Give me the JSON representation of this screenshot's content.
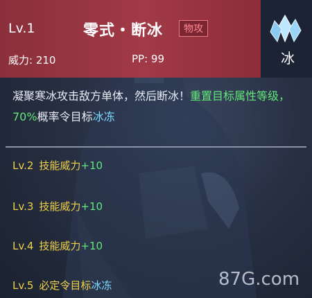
{
  "header": {
    "level": "Lv.1",
    "skill_name": "零式・断冰",
    "category_tag": "物攻",
    "power_label": "威力: 210",
    "pp_label": "PP: 99"
  },
  "element": {
    "icon": "ice-crystal-icon",
    "label": "冰"
  },
  "description": {
    "part1": "凝聚寒冰攻击敌方单体，然后断冰！",
    "part2": "重置目标属性等级，",
    "part3": "70%",
    "part4": "概率令目标",
    "part5": "冰冻"
  },
  "upgrades": [
    {
      "level": "Lv.2",
      "text": "技能威力",
      "value": "+10"
    },
    {
      "level": "Lv.3",
      "text": "技能威力",
      "value": "+10"
    },
    {
      "level": "Lv.4",
      "text": "技能威力",
      "value": "+10"
    },
    {
      "level": "Lv.5",
      "text": "必定令目标",
      "value": "冰冻"
    }
  ],
  "watermark": "87G.com",
  "colors": {
    "header": "#a13a46",
    "highlight_green": "#62e87a",
    "highlight_cyan": "#7ddcff",
    "level_yellow": "#f0d24a"
  }
}
